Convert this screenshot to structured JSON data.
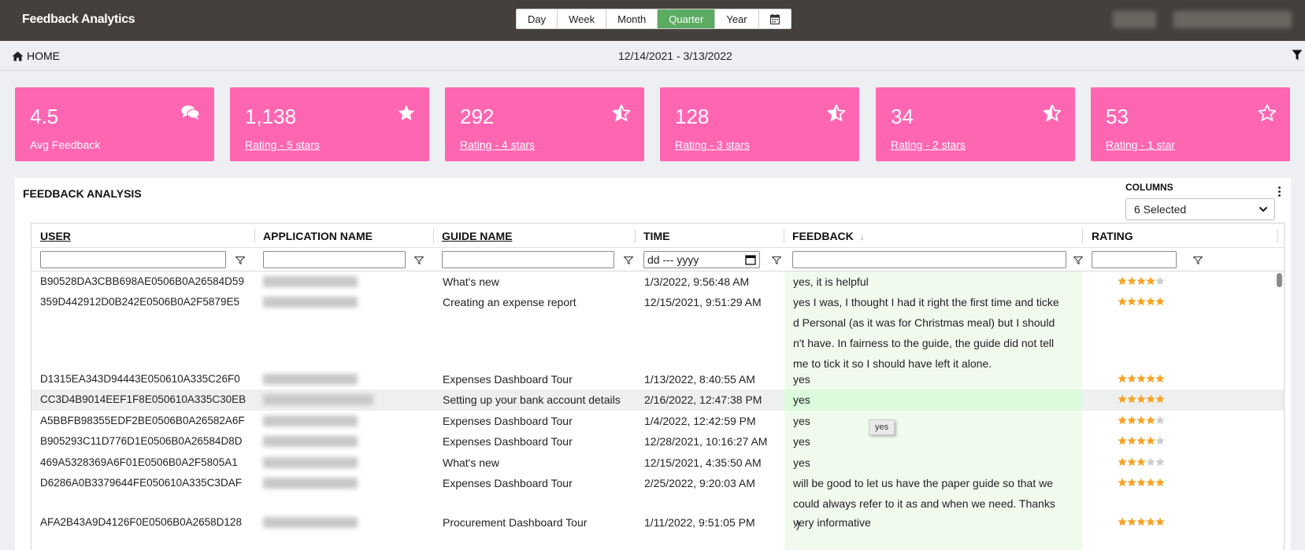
{
  "header": {
    "title": "Feedback Analytics",
    "periods": [
      "Day",
      "Week",
      "Month",
      "Quarter",
      "Year"
    ],
    "active_period": "Quarter"
  },
  "nav": {
    "home_label": "HOME",
    "date_range": "12/14/2021 - 3/13/2022"
  },
  "cards": [
    {
      "value": "4.5",
      "label": "Avg Feedback",
      "icon": "comments-icon"
    },
    {
      "value": "1,138",
      "label": "Rating - 5 stars",
      "icon": "star-full-icon"
    },
    {
      "value": "292",
      "label": "Rating - 4 stars",
      "icon": "star-half-icon"
    },
    {
      "value": "128",
      "label": "Rating - 3 stars",
      "icon": "star-half-icon"
    },
    {
      "value": "34",
      "label": "Rating - 2 stars",
      "icon": "star-half-icon"
    },
    {
      "value": "53",
      "label": "Rating - 1 star",
      "icon": "star-outline-icon"
    }
  ],
  "panel": {
    "title": "FEEDBACK ANALYSIS",
    "columns_label": "COLUMNS",
    "columns_value": "6 Selected"
  },
  "table": {
    "headers": [
      "USER",
      "APPLICATION NAME",
      "GUIDE NAME",
      "TIME",
      "FEEDBACK",
      "RATING"
    ],
    "date_placeholder": "dd --- yyyy",
    "rows": [
      {
        "user": "B90528DA3CBB698AE0506B0A26584D59",
        "guide": "What's new",
        "time": "1/3/2022, 9:56:48 AM",
        "feedback": "yes, it is helpful",
        "rating": 4
      },
      {
        "user": "359D442912D0B242E0506B0A2F5879E5",
        "guide": "Creating an expense report",
        "time": "12/15/2021, 9:51:29 AM",
        "feedback": "yes I was, I thought I had it right the first time and ticked Personal (as it was for Christmas meal) but I shouldn't have. In fairness to the guide, the guide did not tell me to tick it so I should have left it alone.",
        "rating": 5
      },
      {
        "user": "D1315EA343D94443E050610A335C26F0",
        "guide": "Expenses Dashboard Tour",
        "time": "1/13/2022, 8:40:55 AM",
        "feedback": "yes",
        "rating": 5
      },
      {
        "user": "CC3D4B9014EEF1F8E050610A335C30EB",
        "guide": "Setting up your bank account details",
        "time": "2/16/2022, 12:47:38 PM",
        "feedback": "yes",
        "rating": 5
      },
      {
        "user": "A5BBFB98355EDF2BE0506B0A26582A6F",
        "guide": "Expenses Dashboard Tour",
        "time": "1/4/2022, 12:42:59 PM",
        "feedback": "yes",
        "rating": 4
      },
      {
        "user": "B905293C11D776D1E0506B0A26584D8D",
        "guide": "Expenses Dashboard Tour",
        "time": "12/28/2021, 10:16:27 AM",
        "feedback": "yes",
        "rating": 4
      },
      {
        "user": "469A5328369A6F01E0506B0A2F5805A1",
        "guide": "What's new",
        "time": "12/15/2021, 4:35:50 AM",
        "feedback": "yes",
        "rating": 3
      },
      {
        "user": "D6286A0B3379644FE050610A335C3DAF",
        "guide": "Expenses Dashboard Tour",
        "time": "2/25/2022, 9:20:03 AM",
        "feedback": "will be good to let us have the paper guide so that we could always refer to it as and when we need. Thanks :)",
        "rating": 5
      },
      {
        "user": "AFA2B43A9D4126F0E0506B0A2658D128",
        "guide": "Procurement Dashboard Tour",
        "time": "1/11/2022, 9:51:05 PM",
        "feedback": "very informative",
        "rating": 5
      }
    ]
  },
  "tooltip": "yes",
  "colors": {
    "topbar": "#45403b",
    "card": "#ff66b2",
    "active_period": "#5cab62",
    "star": "#f7a325"
  }
}
